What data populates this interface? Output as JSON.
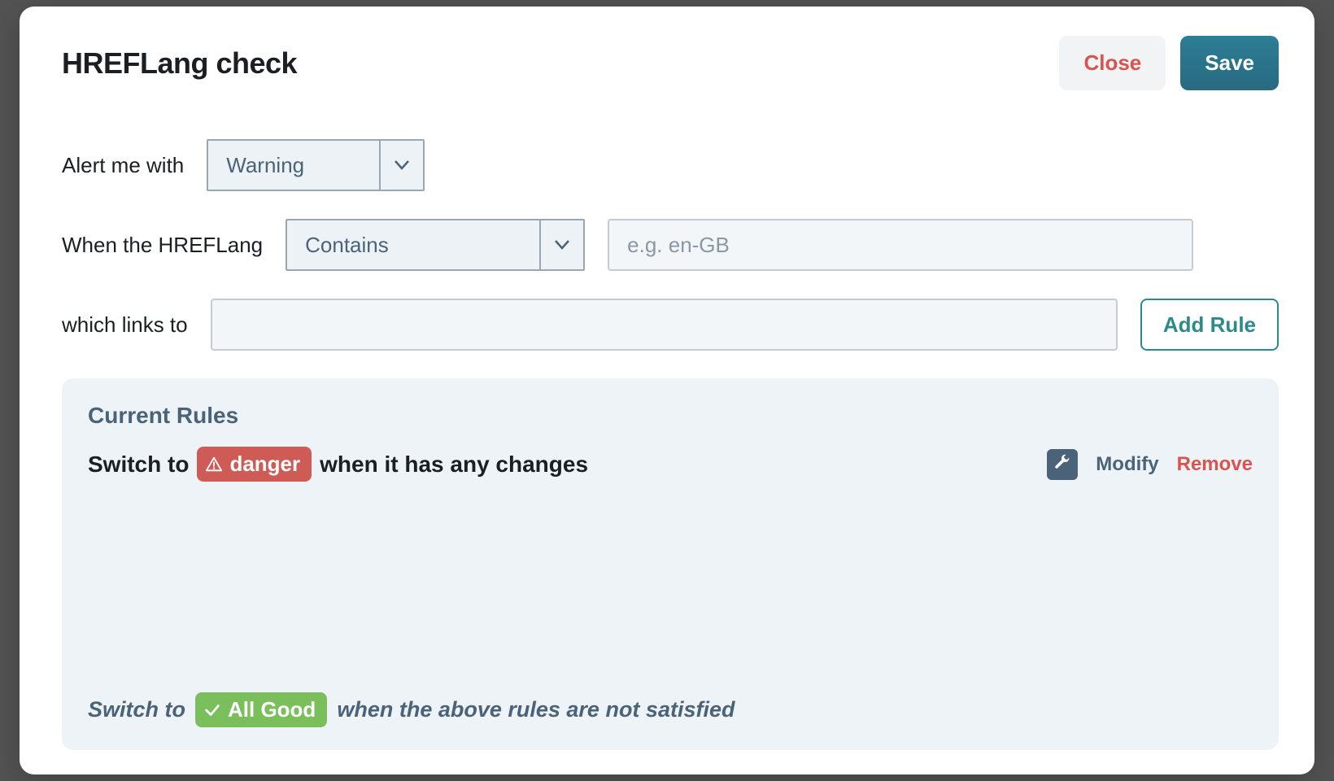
{
  "modal": {
    "title": "HREFLang check",
    "close_label": "Close",
    "save_label": "Save"
  },
  "form": {
    "alert_label": "Alert me with",
    "alert_value": "Warning",
    "when_label": "When the HREFLang",
    "condition_value": "Contains",
    "value_placeholder": "e.g. en-GB",
    "value_input": "",
    "links_label": "which links to",
    "links_input": "",
    "add_rule_label": "Add Rule"
  },
  "rules": {
    "title": "Current Rules",
    "items": [
      {
        "prefix": "Switch to",
        "badge_type": "danger",
        "badge_label": "danger",
        "suffix": "when it has any changes",
        "modify_label": "Modify",
        "remove_label": "Remove"
      }
    ],
    "fallback": {
      "prefix": "Switch to",
      "badge_label": "All Good",
      "suffix": "when the above rules are not satisfied"
    }
  },
  "colors": {
    "teal": "#2d6f86",
    "slate": "#4a6379",
    "danger_bg": "#cf5b56",
    "good_bg": "#7abf5b",
    "close_text": "#d9534f"
  }
}
